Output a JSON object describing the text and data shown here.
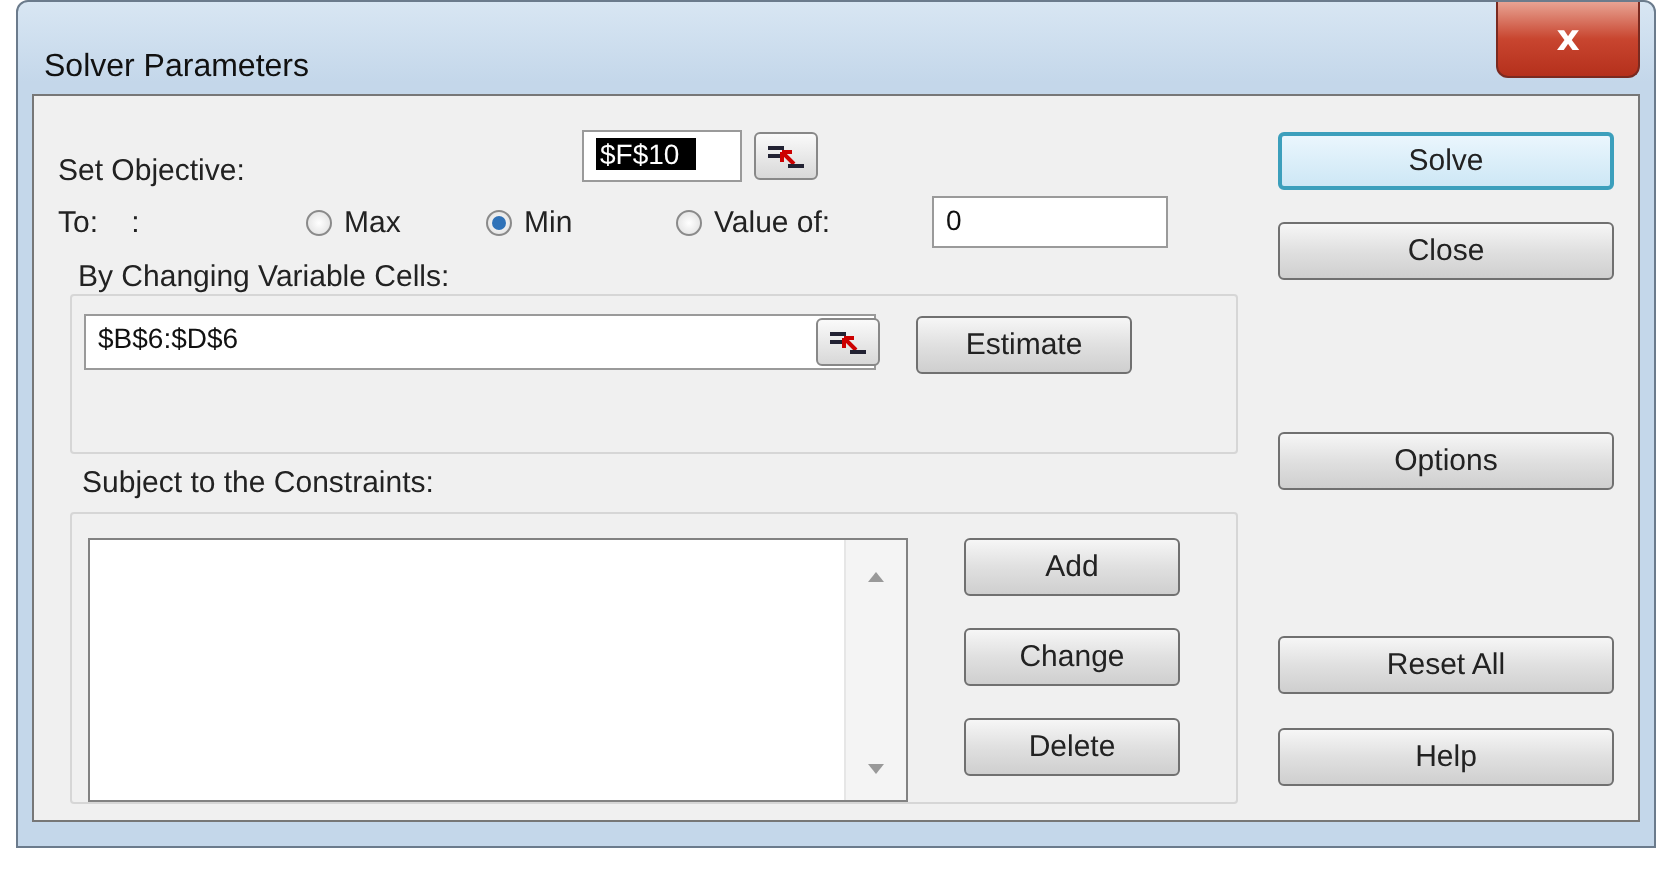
{
  "window": {
    "title": "Solver Parameters",
    "close_symbol": "x"
  },
  "objective": {
    "label": "Set Objective:",
    "value": "$F$10"
  },
  "to": {
    "label": "To:    :",
    "options": [
      {
        "label": "Max",
        "selected": false
      },
      {
        "label": "Min",
        "selected": true
      },
      {
        "label": "Value of:",
        "selected": false
      }
    ],
    "value": "0"
  },
  "variables": {
    "label": "By Changing Variable Cells:",
    "value": "$B$6:$D$6",
    "button": "Estimate"
  },
  "constraints": {
    "label": "Subject to the Constraints:",
    "buttons": [
      "Add",
      "Change",
      "Delete"
    ]
  },
  "side_buttons": [
    {
      "label": "Solve",
      "kind": "default"
    },
    {
      "label": "Close",
      "kind": "normal"
    },
    {
      "label": "Options",
      "kind": "normal"
    },
    {
      "label": "Reset All",
      "kind": "normal"
    },
    {
      "label": "Help",
      "kind": "normal"
    }
  ]
}
